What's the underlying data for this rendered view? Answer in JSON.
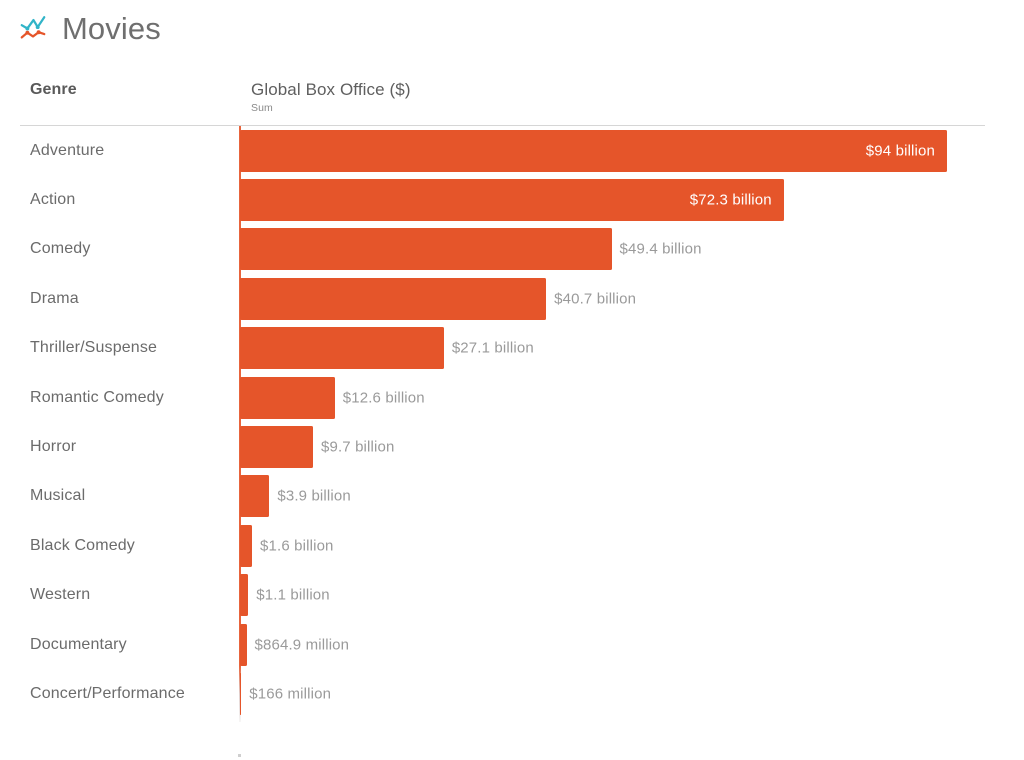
{
  "header": {
    "title": "Movies",
    "icon": "line-chart-icon"
  },
  "columns": {
    "genre_header": "Genre",
    "measure_header": "Global Box Office ($)",
    "measure_aggregation": "Sum"
  },
  "colors": {
    "bar": "#e5552a",
    "bar_label_inside": "#ffffff",
    "bar_label_outside": "#9a9a9a",
    "axis": "#e8643c",
    "rule": "#d6d6d6",
    "text": "#6b6b6b"
  },
  "chart_data": {
    "type": "bar",
    "orientation": "horizontal",
    "title": "Movies",
    "xlabel": "Global Box Office ($)",
    "ylabel": "Genre",
    "aggregation": "Sum",
    "unit": "USD",
    "grid": false,
    "legend": null,
    "xlim": [
      0,
      94
    ],
    "value_unit_note": "values in billions of USD",
    "categories": [
      "Adventure",
      "Action",
      "Comedy",
      "Drama",
      "Thriller/Suspense",
      "Romantic Comedy",
      "Horror",
      "Musical",
      "Black Comedy",
      "Western",
      "Documentary",
      "Concert/Performance"
    ],
    "values": [
      94,
      72.3,
      49.4,
      40.7,
      27.1,
      12.6,
      9.7,
      3.9,
      1.6,
      1.1,
      0.8649,
      0.166
    ],
    "labels": [
      "$94 billion",
      "$72.3 billion",
      "$49.4 billion",
      "$40.7 billion",
      "$27.1 billion",
      "$12.6 billion",
      "$9.7 billion",
      "$3.9 billion",
      "$1.6 billion",
      "$1.1 billion",
      "$864.9 million",
      "$166 million"
    ],
    "label_placement": [
      "inside",
      "inside",
      "outside",
      "outside",
      "outside",
      "outside",
      "outside",
      "outside",
      "outside",
      "outside",
      "outside",
      "outside"
    ]
  }
}
